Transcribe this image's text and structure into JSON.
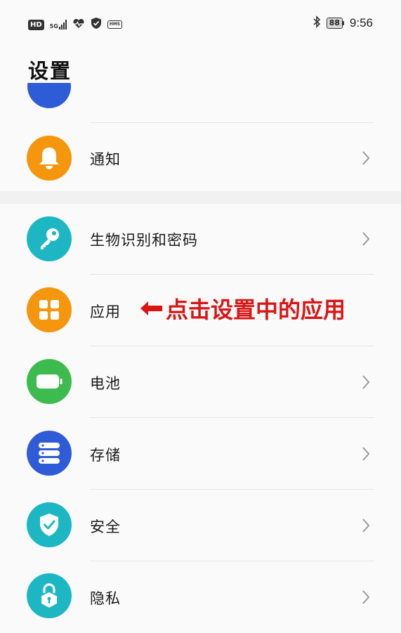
{
  "status_bar": {
    "hd": "HD",
    "network_type": "5G",
    "hms": "HMS",
    "battery_level": "88",
    "time": "9:56"
  },
  "page": {
    "title": "设置"
  },
  "items": [
    {
      "label": "通知",
      "icon": "bell-icon",
      "color": "#f5960c"
    },
    {
      "label": "生物识别和密码",
      "icon": "key-icon",
      "color": "#1db7c4"
    },
    {
      "label": "应用",
      "icon": "app-grid-icon",
      "color": "#f5960c"
    },
    {
      "label": "电池",
      "icon": "battery-icon",
      "color": "#3dbb4e"
    },
    {
      "label": "存储",
      "icon": "storage-icon",
      "color": "#2e5bd6"
    },
    {
      "label": "安全",
      "icon": "shield-check-icon",
      "color": "#1db7c4"
    },
    {
      "label": "隐私",
      "icon": "privacy-lock-icon",
      "color": "#1db7c4"
    }
  ],
  "annotation": {
    "text": "点击设置中的应用",
    "color": "#d91515"
  }
}
